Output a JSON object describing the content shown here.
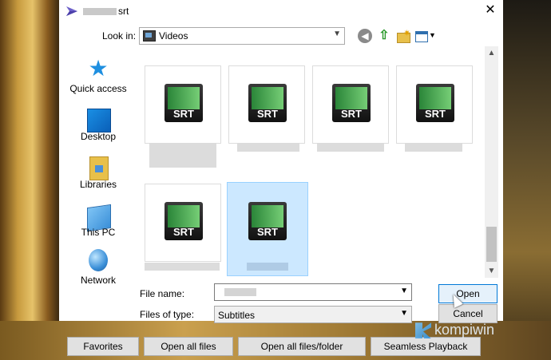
{
  "window": {
    "title_suffix": "srt",
    "close_glyph": "✕"
  },
  "lookin": {
    "label": "Look in:",
    "value": "Videos"
  },
  "places": [
    {
      "label": "Quick access"
    },
    {
      "label": "Desktop"
    },
    {
      "label": "Libraries"
    },
    {
      "label": "This PC"
    },
    {
      "label": "Network"
    }
  ],
  "files": [
    {
      "icon_text": "SRT"
    },
    {
      "icon_text": "SRT"
    },
    {
      "icon_text": "SRT"
    },
    {
      "icon_text": "SRT"
    },
    {
      "icon_text": "SRT"
    },
    {
      "icon_text": "SRT"
    }
  ],
  "filename": {
    "label": "File name:"
  },
  "filetype": {
    "label": "Files of type:",
    "value": "Subtitles"
  },
  "buttons": {
    "open": "Open",
    "cancel": "Cancel"
  },
  "bottom": {
    "favorites": "Favorites",
    "open_all_files": "Open all files",
    "open_all_folder": "Open all files/folder",
    "seamless": "Seamless Playback"
  },
  "watermark": "kompiwin",
  "colors": {
    "selection": "#cce8ff",
    "accent": "#0078d7",
    "srt_green": "#2fbf4a"
  }
}
